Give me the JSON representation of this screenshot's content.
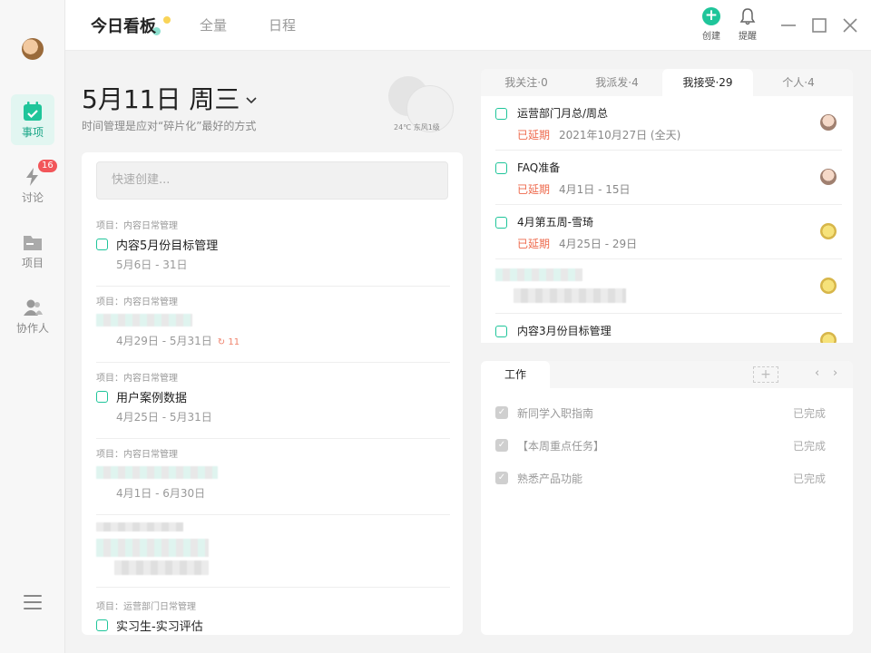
{
  "topbar": {
    "tabs": [
      {
        "label": "今日看板",
        "active": true
      },
      {
        "label": "全量",
        "active": false
      },
      {
        "label": "日程",
        "active": false
      }
    ],
    "create_label": "创建",
    "remind_label": "提醒"
  },
  "sidebar": {
    "items": [
      {
        "label": "事项",
        "icon": "calendar-check-icon",
        "active": true
      },
      {
        "label": "讨论",
        "icon": "lightning-icon",
        "badge": "16"
      },
      {
        "label": "项目",
        "icon": "folder-icon"
      },
      {
        "label": "协作人",
        "icon": "people-icon"
      }
    ]
  },
  "header": {
    "date": "5月11日 周三",
    "subtitle": "时间管理是应对“碎片化”最好的方式",
    "weather": "24℃ 东风1级"
  },
  "quick_create": {
    "placeholder": "快速创建..."
  },
  "tasks": [
    {
      "project": "项目：内容日常管理",
      "title": "内容5月份目标管理",
      "range": "5月6日 - 31日"
    },
    {
      "project": "项目：内容日常管理",
      "title": "",
      "range": "4月29日 - 5月31日",
      "repeat": "↻ 11"
    },
    {
      "project": "项目：内容日常管理",
      "title": "用户案例数据",
      "range": "4月25日 - 5月31日"
    },
    {
      "project": "项目：内容日常管理",
      "title": "",
      "range": "4月1日 - 6月30日"
    },
    {
      "project": "",
      "title": "",
      "range": ""
    },
    {
      "project": "项目：运营部门日常管理",
      "title": "实习生-实习评估",
      "range": ""
    }
  ],
  "right_tabs": [
    {
      "label": "我关注·0",
      "active": false
    },
    {
      "label": "我派发·4",
      "active": false
    },
    {
      "label": "我接受·29",
      "active": true
    },
    {
      "label": "个人·4",
      "active": false
    }
  ],
  "received": [
    {
      "title": "运营部门月总/周总",
      "status": "已延期",
      "when": "2021年10月27日 (全天)"
    },
    {
      "title": "FAQ准备",
      "status": "已延期",
      "when": "4月1日 - 15日"
    },
    {
      "title": "4月第五周-雪琦",
      "status": "已延期",
      "when": "4月25日 - 29日"
    },
    {
      "title": "",
      "status": "",
      "when": ""
    },
    {
      "title": "内容3月份目标管理",
      "status": "",
      "when": ""
    }
  ],
  "work": {
    "tab_label": "工作",
    "add_label": "+",
    "items": [
      {
        "title": "新同学入职指南",
        "status": "已完成"
      },
      {
        "title": "【本周重点任务】",
        "status": "已完成"
      },
      {
        "title": "熟悉产品功能",
        "status": "已完成"
      }
    ]
  }
}
